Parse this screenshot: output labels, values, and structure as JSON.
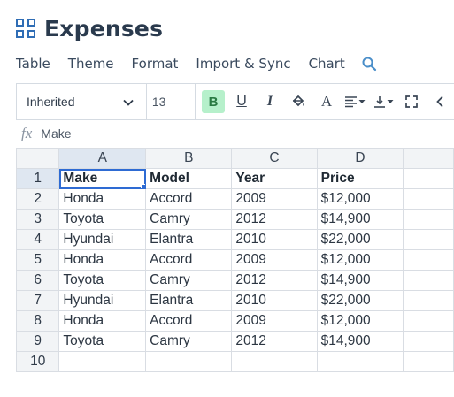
{
  "app": {
    "title": "Expenses"
  },
  "menu": {
    "items": [
      "Table",
      "Theme",
      "Format",
      "Import & Sync",
      "Chart"
    ]
  },
  "toolbar": {
    "font_name": "Inherited",
    "font_size": "13",
    "bold_label": "B",
    "underline_label": "U",
    "italic_label": "I",
    "text_color_label": "A",
    "active_color": "#b6f0cb"
  },
  "formula_bar": {
    "fx_label": "fx",
    "value": "Make"
  },
  "sheet": {
    "columns": [
      "A",
      "B",
      "C",
      "D",
      ""
    ],
    "rows": [
      {
        "num": "1",
        "cells": [
          "Make",
          "Model",
          "Year",
          "Price",
          ""
        ]
      },
      {
        "num": "2",
        "cells": [
          "Honda",
          "Accord",
          "2009",
          "$12,000",
          ""
        ]
      },
      {
        "num": "3",
        "cells": [
          "Toyota",
          "Camry",
          "2012",
          "$14,900",
          ""
        ]
      },
      {
        "num": "4",
        "cells": [
          "Hyundai",
          "Elantra",
          "2010",
          "$22,000",
          ""
        ]
      },
      {
        "num": "5",
        "cells": [
          "Honda",
          "Accord",
          "2009",
          "$12,000",
          ""
        ]
      },
      {
        "num": "6",
        "cells": [
          "Toyota",
          "Camry",
          "2012",
          "$14,900",
          ""
        ]
      },
      {
        "num": "7",
        "cells": [
          "Hyundai",
          "Elantra",
          "2010",
          "$22,000",
          ""
        ]
      },
      {
        "num": "8",
        "cells": [
          "Honda",
          "Accord",
          "2009",
          "$12,000",
          ""
        ]
      },
      {
        "num": "9",
        "cells": [
          "Toyota",
          "Camry",
          "2012",
          "$14,900",
          ""
        ]
      },
      {
        "num": "10",
        "cells": [
          "",
          "",
          "",
          "",
          ""
        ]
      }
    ],
    "selected_cell": "A1",
    "selection_color": "#2e6bd3"
  }
}
